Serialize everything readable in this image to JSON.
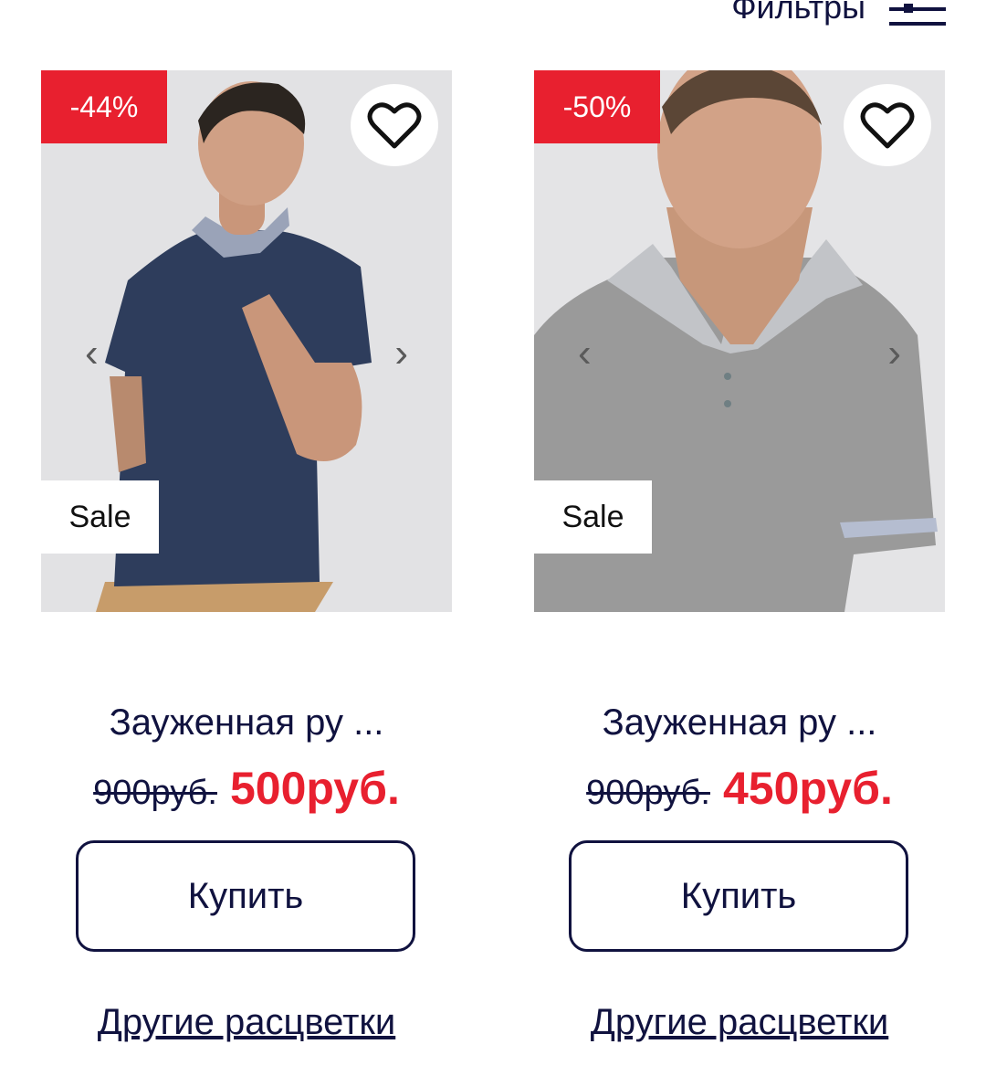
{
  "header": {
    "filters_label": "Фильтры",
    "filters_icon": "sliders-icon"
  },
  "products": [
    {
      "discount": "-44%",
      "badge": "Sale",
      "title": "Зауженная ру ...",
      "old_price": "900руб.",
      "new_price": "500руб.",
      "buy_label": "Купить",
      "colors_link": "Другие расцветки",
      "shirt_color": "#2e3d5c"
    },
    {
      "discount": "-50%",
      "badge": "Sale",
      "title": "Зауженная ру ...",
      "old_price": "900руб.",
      "new_price": "450руб.",
      "buy_label": "Купить",
      "colors_link": "Другие расцветки",
      "shirt_color": "#9a9a9a"
    }
  ],
  "carousel": {
    "prev_glyph": "‹",
    "next_glyph": "›"
  },
  "colors": {
    "accent_red": "#e8202f",
    "navy_text": "#10123f"
  }
}
